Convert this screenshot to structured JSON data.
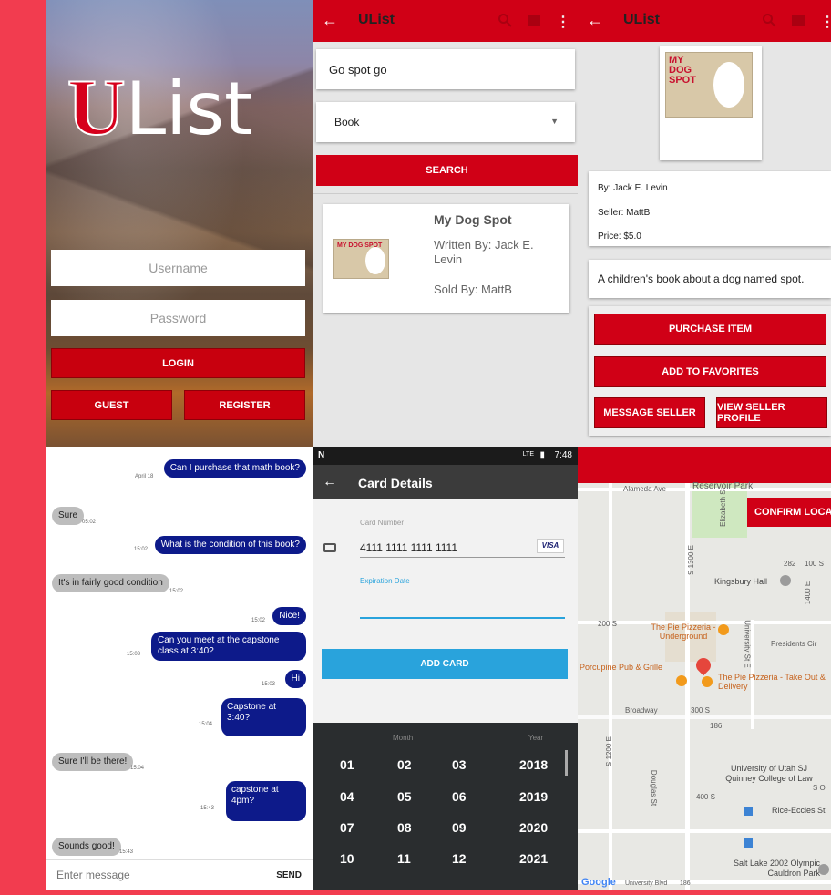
{
  "login": {
    "logo_u": "U",
    "logo_rest": "List",
    "username_placeholder": "Username",
    "password_placeholder": "Password",
    "login_label": "LOGIN",
    "guest_label": "GUEST",
    "register_label": "REGISTER"
  },
  "search": {
    "app_title": "UList",
    "query": "Go spot go",
    "category": "Book",
    "search_label": "SEARCH",
    "result": {
      "title": "My Dog Spot",
      "author": "Written By: Jack E. Levin",
      "seller": "Sold By: MattB",
      "cover_text": "MY DOG SPOT"
    }
  },
  "detail": {
    "app_title": "UList",
    "cover_text": "MY DOG SPOT",
    "by": "By: Jack E. Levin",
    "seller": "Seller: MattB",
    "price": "Price: $5.0",
    "description": "A children's book about a dog named spot.",
    "purchase_label": "PURCHASE ITEM",
    "favorites_label": "ADD TO FAVORITES",
    "message_label": "MESSAGE SELLER",
    "profile_label": "VIEW SELLER PROFILE"
  },
  "chat": {
    "messages": [
      {
        "dir": "out",
        "text": "Can I purchase that math book?",
        "time": "April 18"
      },
      {
        "dir": "in",
        "text": "Sure",
        "time": "05:02"
      },
      {
        "dir": "out",
        "text": "What is the condition of this book?",
        "time": "15:02"
      },
      {
        "dir": "in",
        "text": "It's in fairly good condition",
        "time": "15:02"
      },
      {
        "dir": "out",
        "text": "Nice!",
        "time": "15:02"
      },
      {
        "dir": "out",
        "text": "Can you meet at the capstone class at 3:40?",
        "time": "15:03"
      },
      {
        "dir": "out",
        "text": "Hi",
        "time": "15:03"
      },
      {
        "dir": "out",
        "text": "Capstone at 3:40?",
        "time": "15:04"
      },
      {
        "dir": "in",
        "text": "Sure I'll be there!",
        "time": "15:04"
      },
      {
        "dir": "out",
        "text": "capstone at 4pm?",
        "time": "15:43"
      },
      {
        "dir": "in",
        "text": "Sounds good!",
        "time": "15:43"
      }
    ],
    "input_placeholder": "Enter message",
    "send_label": "SEND"
  },
  "card": {
    "status_logo": "N",
    "status_net": "LTE",
    "status_time": "7:48",
    "title": "Card Details",
    "number_label": "Card Number",
    "number_value": "4111 1111 1111 1111",
    "card_brand": "VISA",
    "expiration_label": "Expiration Date",
    "add_label": "ADD CARD",
    "month_label": "Month",
    "year_label": "Year",
    "months": [
      "01",
      "02",
      "03",
      "04",
      "05",
      "06",
      "07",
      "08",
      "09",
      "10",
      "11",
      "12"
    ],
    "years": [
      "2018",
      "2019",
      "2020",
      "2021"
    ]
  },
  "map": {
    "confirm_label": "CONFIRM LOCATION",
    "labels": {
      "alameda": "Alameda Ave",
      "reservoir": "Reservoir Park",
      "s1300e": "S 1300 E",
      "elizabeth": "Elizabeth St",
      "r282": "282",
      "s100": "100 S",
      "kingsbury": "Kingsbury Hall",
      "s1400e": "1400 E",
      "s200": "200 S",
      "university": "University St E",
      "presidents": "Presidents Cir",
      "pie_under": "The Pie Pizzeria - Underground",
      "porcupine": "Porcupine Pub & Grille",
      "pie_take": "The Pie Pizzeria - Take Out & Delivery",
      "broadway": "Broadway",
      "s300": "300 S",
      "r186": "186",
      "s1200e": "S 1200 E",
      "douglas": "Douglas St",
      "law": "University of Utah SJ Quinney College of Law",
      "s400": "400 S",
      "rice": "Rice-Eccles St",
      "so": "S O",
      "olympic": "Salt Lake 2002 Olympic Cauldron Park",
      "google": "Google",
      "univ_blvd": "University Blvd",
      "r186b": "186"
    }
  }
}
